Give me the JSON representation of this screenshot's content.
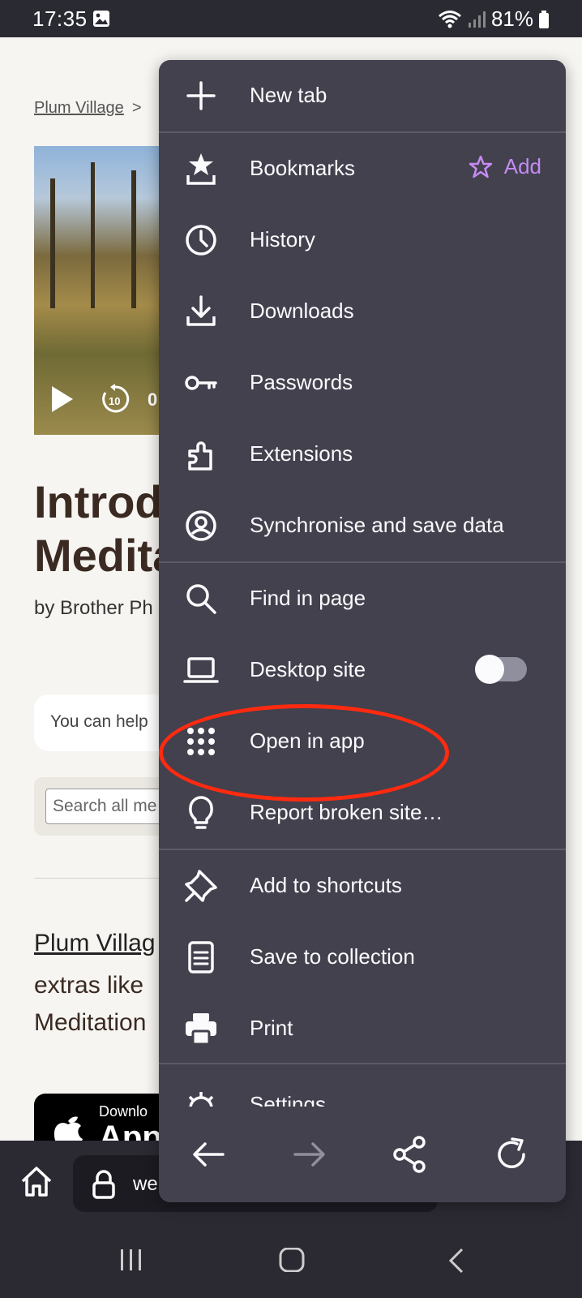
{
  "status_bar": {
    "time": "17:35",
    "battery": "81%"
  },
  "page": {
    "breadcrumb": {
      "link": "Plum Village",
      "separator": ">"
    },
    "video": {
      "time_prefix": "0"
    },
    "title_lines": [
      "Introdu",
      "Medita"
    ],
    "byline": "by Brother Ph",
    "help_text": "You can help",
    "search_placeholder": "Search all me",
    "link_text": "Plum Villag",
    "paragraph": "extras like Meditation",
    "appstore": {
      "small": "Downlo",
      "big": "App"
    }
  },
  "url_bar": {
    "text": "we"
  },
  "menu": {
    "items": [
      {
        "label": "New tab",
        "icon": "plus-icon"
      },
      {
        "label": "Bookmarks",
        "icon": "bookmarks-icon",
        "action": "Add"
      },
      {
        "label": "History",
        "icon": "clock-icon"
      },
      {
        "label": "Downloads",
        "icon": "download-icon"
      },
      {
        "label": "Passwords",
        "icon": "key-icon"
      },
      {
        "label": "Extensions",
        "icon": "puzzle-icon"
      },
      {
        "label": "Synchronise and save data",
        "icon": "account-icon"
      },
      {
        "label": "Find in page",
        "icon": "search-icon"
      },
      {
        "label": "Desktop site",
        "icon": "laptop-icon",
        "toggle": false
      },
      {
        "label": "Open in app",
        "icon": "apps-grid-icon"
      },
      {
        "label": "Report broken site…",
        "icon": "lightbulb-icon"
      },
      {
        "label": "Add to shortcuts",
        "icon": "pin-icon"
      },
      {
        "label": "Save to collection",
        "icon": "collection-icon"
      },
      {
        "label": "Print",
        "icon": "printer-icon"
      }
    ],
    "partial_label": "Settings"
  },
  "colors": {
    "menu_bg": "#42414d",
    "accent": "#c58af5",
    "annotation": "#ff2a10"
  }
}
